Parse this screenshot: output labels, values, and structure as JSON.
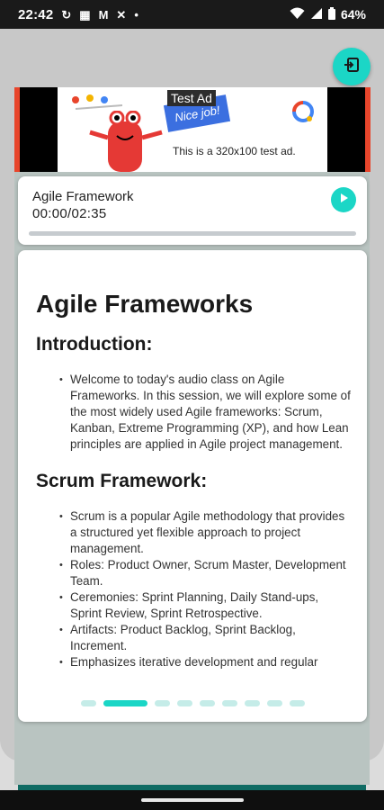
{
  "status_bar": {
    "time": "22:42",
    "battery": "64%"
  },
  "colors": {
    "accent": "#1bd6c6",
    "card": "#ffffff",
    "progress_track": "#c6cbcf"
  },
  "ad": {
    "label": "Test Ad",
    "ribbon_text": "Nice job!",
    "text": "This is a 320x100 test ad."
  },
  "player": {
    "title": "Agile Framework",
    "time": "00:00/02:35",
    "progress": 0
  },
  "document": {
    "title": "Agile Frameworks",
    "sections": [
      {
        "heading": "Introduction:",
        "bullets": [
          "Welcome to today's audio class on Agile Frameworks. In this session, we will explore some of the most widely used Agile frameworks: Scrum, Kanban, Extreme Programming (XP), and how Lean principles are applied in Agile project management."
        ]
      },
      {
        "heading": "Scrum Framework:",
        "bullets": [
          "Scrum is a popular Agile methodology that provides a structured yet flexible approach to project management.",
          "Roles: Product Owner, Scrum Master, Development Team.",
          "Ceremonies: Sprint Planning, Daily Stand-ups, Sprint Review, Sprint Retrospective.",
          "Artifacts: Product Backlog, Sprint Backlog, Increment.",
          "Emphasizes iterative development and regular"
        ]
      }
    ]
  },
  "pager": {
    "count": 9,
    "active_index": 1
  }
}
